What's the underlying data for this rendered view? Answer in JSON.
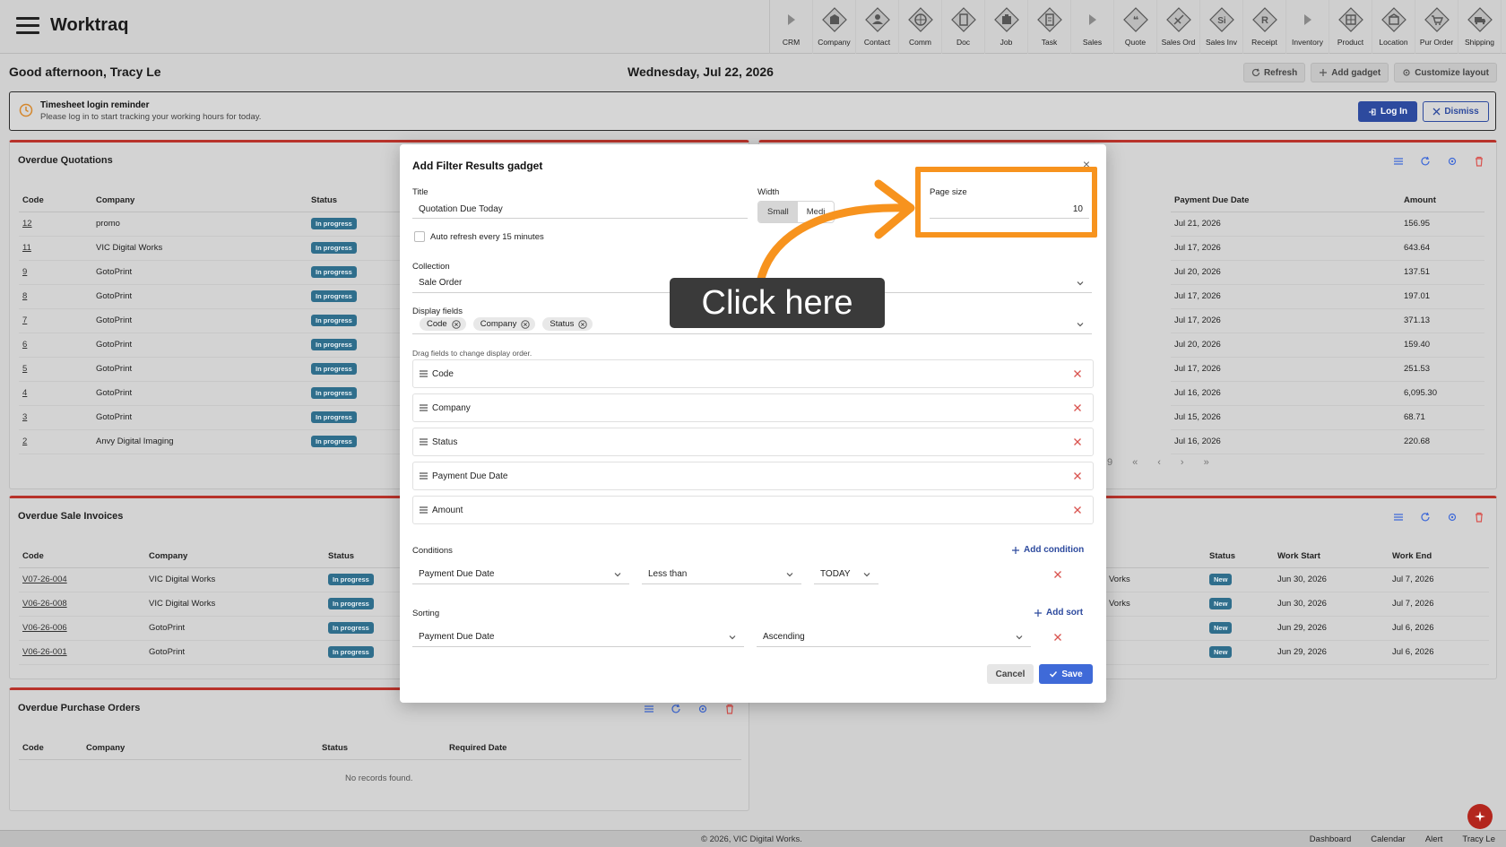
{
  "app": {
    "title": "Worktraq"
  },
  "nav": [
    {
      "label": "CRM",
      "icon": "triangle-right-icon"
    },
    {
      "label": "Company",
      "icon": "company-icon"
    },
    {
      "label": "Contact",
      "icon": "contact-icon"
    },
    {
      "label": "Comm",
      "icon": "comm-icon"
    },
    {
      "label": "Doc",
      "icon": "doc-icon"
    },
    {
      "label": "Job",
      "icon": "job-icon"
    },
    {
      "label": "Task",
      "icon": "task-icon"
    },
    {
      "label": "Sales",
      "icon": "triangle-right-icon"
    },
    {
      "label": "Quote",
      "icon": "quote-icon"
    },
    {
      "label": "Sales Ord",
      "icon": "sales-order-icon"
    },
    {
      "label": "Sales Inv",
      "icon": "sales-invoice-icon"
    },
    {
      "label": "Receipt",
      "icon": "receipt-icon"
    },
    {
      "label": "Inventory",
      "icon": "triangle-right-icon"
    },
    {
      "label": "Product",
      "icon": "product-icon"
    },
    {
      "label": "Location",
      "icon": "location-icon"
    },
    {
      "label": "Pur Order",
      "icon": "cart-icon"
    },
    {
      "label": "Shipping",
      "icon": "truck-icon"
    }
  ],
  "nav_glyphs": {
    "quote": "❝",
    "sales_inv": "Si",
    "receipt": "R"
  },
  "greeting": "Good afternoon, Tracy Le",
  "date": "Wednesday, Jul 22, 2026",
  "top_actions": {
    "refresh": "Refresh",
    "add_gadget": "Add gadget",
    "customize": "Customize layout"
  },
  "reminder": {
    "title": "Timesheet login reminder",
    "text": "Please log in to start tracking your working hours for today.",
    "login": "Log In",
    "dismiss": "Dismiss"
  },
  "overdue_quotations": {
    "title": "Overdue Quotations",
    "columns": [
      "Code",
      "Company",
      "Status",
      "Payment Due Date",
      "Amount"
    ],
    "rows": [
      {
        "code": "12",
        "company": "promo",
        "status": "In progress",
        "due": "Jul 21, 2026",
        "amount": "156.95"
      },
      {
        "code": "11",
        "company": "VIC Digital Works",
        "status": "In progress",
        "due": "Jul 17, 2026",
        "amount": "643.64"
      },
      {
        "code": "9",
        "company": "GotoPrint",
        "status": "In progress",
        "due": "Jul 20, 2026",
        "amount": "137.51"
      },
      {
        "code": "8",
        "company": "GotoPrint",
        "status": "In progress",
        "due": "Jul 17, 2026",
        "amount": "197.01"
      },
      {
        "code": "7",
        "company": "GotoPrint",
        "status": "In progress",
        "due": "Jul 17, 2026",
        "amount": "371.13"
      },
      {
        "code": "6",
        "company": "GotoPrint",
        "status": "In progress",
        "due": "Jul 20, 2026",
        "amount": "159.40"
      },
      {
        "code": "5",
        "company": "GotoPrint",
        "status": "In progress",
        "due": "Jul 17, 2026",
        "amount": "251.53"
      },
      {
        "code": "4",
        "company": "GotoPrint",
        "status": "In progress",
        "due": "Jul 16, 2026",
        "amount": "6,095.30"
      },
      {
        "code": "3",
        "company": "GotoPrint",
        "status": "In progress",
        "due": "Jul 15, 2026",
        "amount": "68.71"
      },
      {
        "code": "2",
        "company": "Anvy Digital Imaging",
        "status": "In progress",
        "due": "Jul 16, 2026",
        "amount": "220.68"
      }
    ],
    "pager_fragment": "9",
    "pager": [
      "«",
      "‹",
      "›",
      "»"
    ]
  },
  "overdue_sale_invoices": {
    "title": "Overdue Sale Invoices",
    "columns": [
      "Code",
      "Company",
      "Status"
    ],
    "rows": [
      {
        "code": "V07-26-004",
        "company": "VIC Digital Works",
        "status": "In progress"
      },
      {
        "code": "V06-26-008",
        "company": "VIC Digital Works",
        "status": "In progress"
      },
      {
        "code": "V06-26-006",
        "company": "GotoPrint",
        "status": "In progress"
      },
      {
        "code": "V06-26-001",
        "company": "GotoPrint",
        "status": "In progress"
      }
    ]
  },
  "jobs_panel": {
    "columns": [
      "Status",
      "Work Start",
      "Work End"
    ],
    "rows": [
      {
        "company_fragment": "Vorks",
        "status": "New",
        "start": "Jun 30, 2026",
        "end": "Jul 7, 2026"
      },
      {
        "company_fragment": "Vorks",
        "status": "New",
        "start": "Jun 30, 2026",
        "end": "Jul 7, 2026"
      },
      {
        "company_fragment": "",
        "status": "New",
        "start": "Jun 29, 2026",
        "end": "Jul 6, 2026"
      },
      {
        "company_fragment": "",
        "status": "New",
        "start": "Jun 29, 2026",
        "end": "Jul 6, 2026"
      }
    ]
  },
  "overdue_purchase_orders": {
    "title": "Overdue Purchase Orders",
    "columns": [
      "Code",
      "Company",
      "Status",
      "Required Date"
    ],
    "empty": "No records found."
  },
  "footer": {
    "copyright": "© 2026, VIC Digital Works.",
    "links": [
      "Dashboard",
      "Calendar",
      "Alert",
      "Tracy Le"
    ]
  },
  "modal": {
    "title": "Add Filter Results gadget",
    "close": "×",
    "title_label": "Title",
    "title_value": "Quotation Due Today",
    "width_label": "Width",
    "width_options": [
      "Small",
      "Medi"
    ],
    "page_size_label": "Page size",
    "page_size_value": "10",
    "auto_refresh": "Auto refresh every 15 minutes",
    "collection_label": "Collection",
    "collection_value": "Sale Order",
    "display_fields_label": "Display fields",
    "chips": [
      "Code",
      "Company",
      "Status"
    ],
    "drag_hint": "Drag fields to change display order.",
    "fields": [
      "Code",
      "Company",
      "Status",
      "Payment Due Date",
      "Amount"
    ],
    "conditions_label": "Conditions",
    "add_condition": "Add condition",
    "condition": {
      "field": "Payment Due Date",
      "operator": "Less than",
      "value": "TODAY"
    },
    "sorting_label": "Sorting",
    "add_sort": "Add sort",
    "sort": {
      "field": "Payment Due Date",
      "direction": "Ascending"
    },
    "cancel": "Cancel",
    "save": "Save"
  },
  "callout": {
    "text": "Click here"
  },
  "colors": {
    "accent": "#f7931e",
    "primary": "#3f6ad8",
    "danger": "#d9534f",
    "panel_border": "#b8332b"
  }
}
